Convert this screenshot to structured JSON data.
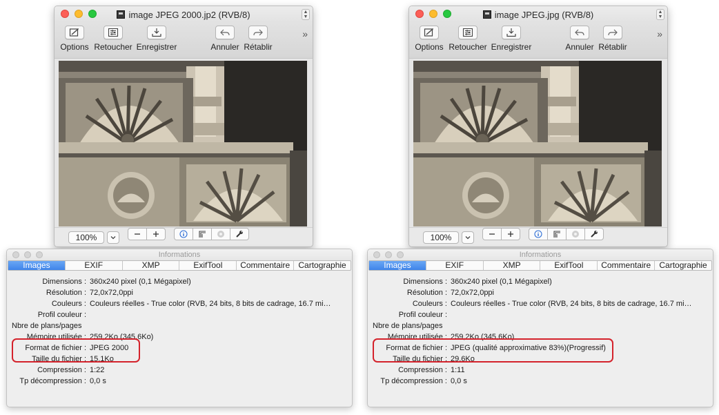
{
  "windows": [
    {
      "id": "left",
      "title": "image JPEG 2000.jp2 (RVB/8)",
      "toolbar": {
        "options": "Options",
        "retoucher": "Retoucher",
        "enregistrer": "Enregistrer",
        "annuler": "Annuler",
        "retablir": "Rétablir",
        "more": "»"
      },
      "zoom": "100%",
      "info": {
        "title": "Informations",
        "tabs": [
          "Images",
          "EXIF",
          "XMP",
          "ExifTool",
          "Commentaire",
          "Cartographie"
        ],
        "active_tab": "Images",
        "rows": [
          {
            "label": "Dimensions :",
            "value": "360x240 pixel (0,1 Mégapixel)"
          },
          {
            "label": "Résolution :",
            "value": "72,0x72,0ppi"
          },
          {
            "label": "Couleurs :",
            "value": "Couleurs réelles - True color (RVB, 24 bits, 8 bits de cadrage, 16.7 mi…"
          },
          {
            "label": "Profil couleur :",
            "value": ""
          },
          {
            "label": "Nbre de plans/pages",
            "value": ""
          },
          {
            "label": "Mémoire utilisée :",
            "value": "259,2Ko (345,6Ko)"
          },
          {
            "label": "Format de fichier :",
            "value": "JPEG 2000"
          },
          {
            "label": "Taille du fichier :",
            "value": "15,1Ko"
          },
          {
            "label": "Compression :",
            "value": "1:22"
          },
          {
            "label": "Tp décompression :",
            "value": "0,0 s"
          }
        ]
      }
    },
    {
      "id": "right",
      "title": "image JPEG.jpg (RVB/8)",
      "toolbar": {
        "options": "Options",
        "retoucher": "Retoucher",
        "enregistrer": "Enregistrer",
        "annuler": "Annuler",
        "retablir": "Rétablir",
        "more": "»"
      },
      "zoom": "100%",
      "info": {
        "title": "Informations",
        "tabs": [
          "Images",
          "EXIF",
          "XMP",
          "ExifTool",
          "Commentaire",
          "Cartographie"
        ],
        "active_tab": "Images",
        "rows": [
          {
            "label": "Dimensions :",
            "value": "360x240 pixel (0,1 Mégapixel)"
          },
          {
            "label": "Résolution :",
            "value": "72,0x72,0ppi"
          },
          {
            "label": "Couleurs :",
            "value": "Couleurs réelles - True color (RVB, 24 bits, 8 bits de cadrage, 16.7 mi…"
          },
          {
            "label": "Profil couleur :",
            "value": ""
          },
          {
            "label": "Nbre de plans/pages",
            "value": ""
          },
          {
            "label": "Mémoire utilisée :",
            "value": "259,2Ko (345,6Ko)"
          },
          {
            "label": "Format de fichier :",
            "value": "JPEG (qualité approximative 83%)(Progressif)"
          },
          {
            "label": "Taille du fichier :",
            "value": "29,6Ko"
          },
          {
            "label": "Compression :",
            "value": "1:11"
          },
          {
            "label": "Tp décompression :",
            "value": "0,0 s"
          }
        ]
      }
    }
  ],
  "colors": {
    "highlight": "#d4222b",
    "active_tab": "#3f84ea",
    "close": "#fc5f57",
    "minimize": "#fdbc2e",
    "zoom": "#28c840"
  }
}
